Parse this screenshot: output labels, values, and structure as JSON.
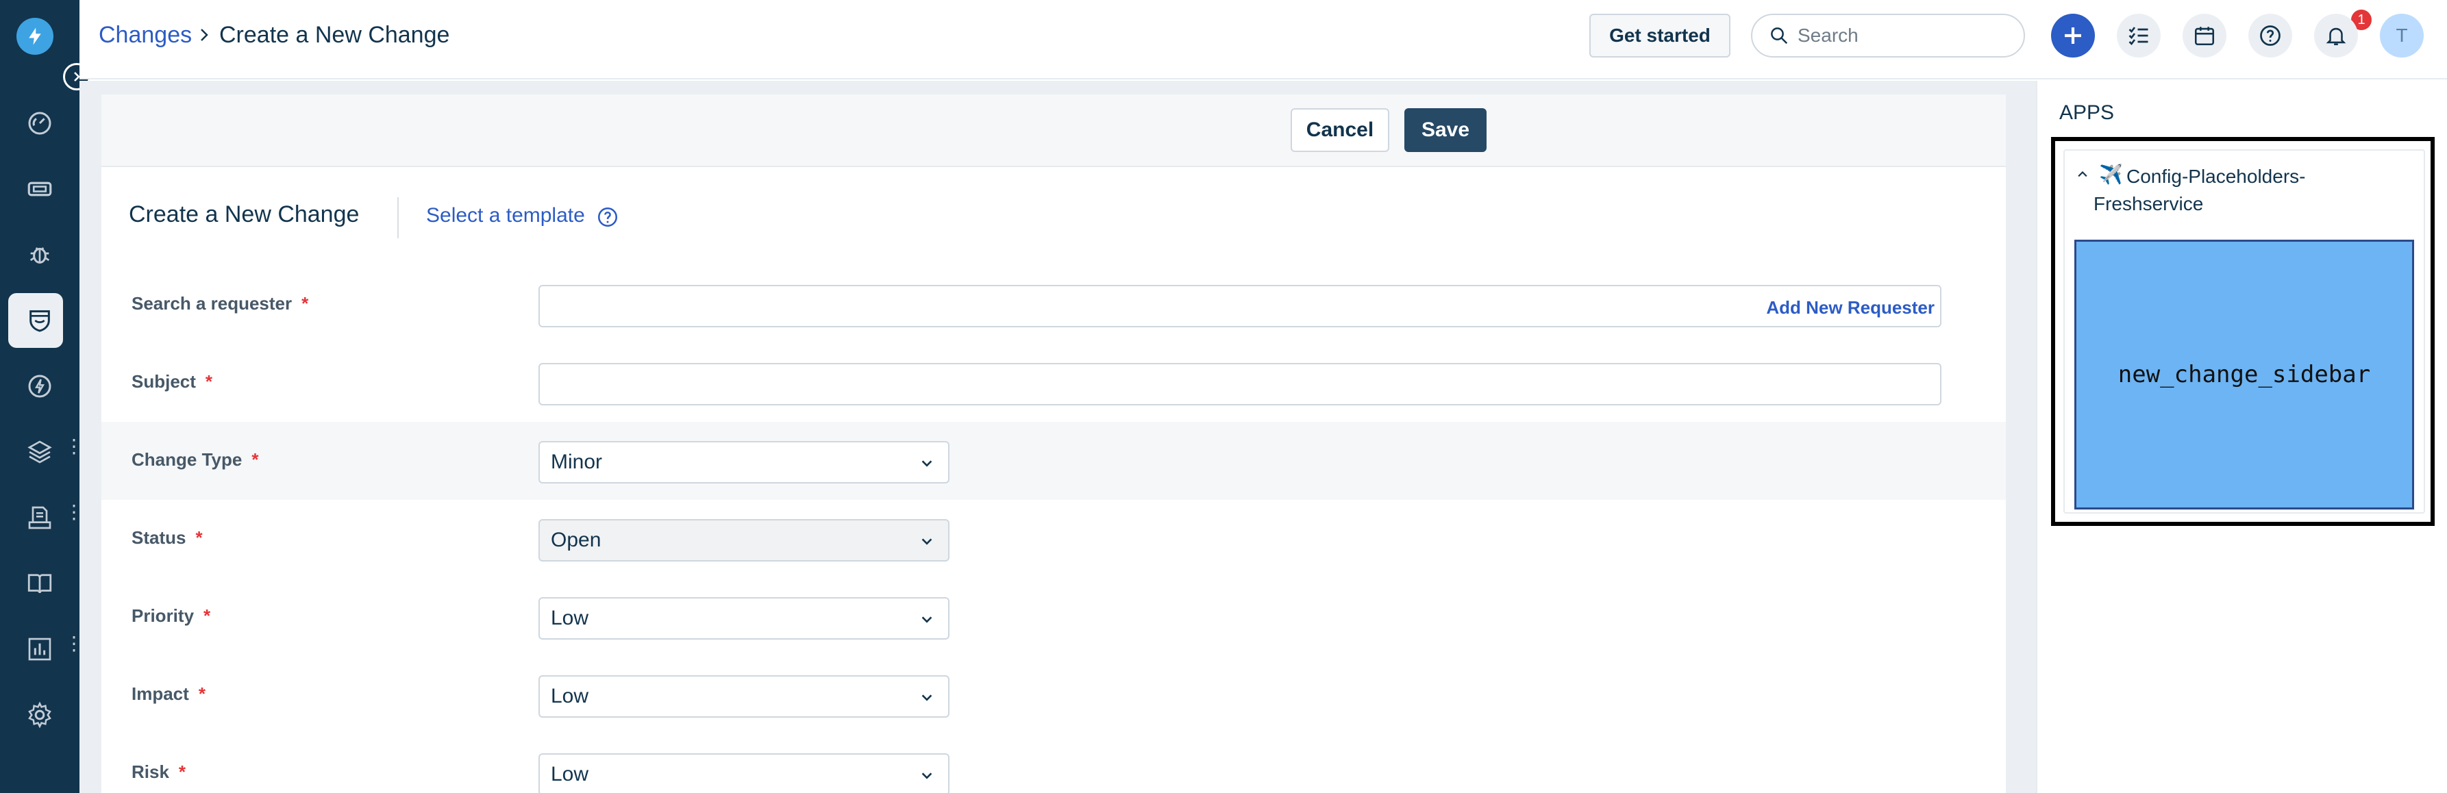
{
  "header": {
    "breadcrumb_link": "Changes",
    "title": "Create a New Change",
    "get_started_label": "Get started",
    "search_placeholder": "Search",
    "help_badge_count": "1",
    "avatar_initial": "T",
    "icons": [
      "plus-icon",
      "todo-list-icon",
      "calendar-icon",
      "help-icon",
      "bell-icon"
    ]
  },
  "sidebar": {
    "items": [
      {
        "name": "dashboard",
        "icon": "gauge-icon"
      },
      {
        "name": "tickets",
        "icon": "ticket-icon"
      },
      {
        "name": "problems",
        "icon": "bug-icon"
      },
      {
        "name": "changes",
        "icon": "shield-icon",
        "active": true
      },
      {
        "name": "releases",
        "icon": "bolt-icon"
      },
      {
        "name": "assets",
        "icon": "layers-icon",
        "has_menu": true
      },
      {
        "name": "contracts",
        "icon": "document-icon",
        "has_menu": true
      },
      {
        "name": "solutions",
        "icon": "book-icon"
      },
      {
        "name": "reports",
        "icon": "chart-icon",
        "has_menu": true
      },
      {
        "name": "admin",
        "icon": "gear-icon"
      }
    ]
  },
  "form": {
    "cancel_label": "Cancel",
    "save_label": "Save",
    "title": "Create a New Change",
    "template_link": "Select a template",
    "fields": {
      "requester": {
        "label": "Search a requester",
        "required": "*",
        "action": "Add New Requester",
        "value": ""
      },
      "subject": {
        "label": "Subject",
        "required": "*",
        "value": ""
      },
      "change_type": {
        "label": "Change Type",
        "required": "*",
        "value": "Minor"
      },
      "status": {
        "label": "Status",
        "required": "*",
        "value": "Open"
      },
      "priority": {
        "label": "Priority",
        "required": "*",
        "value": "Low"
      },
      "impact": {
        "label": "Impact",
        "required": "*",
        "value": "Low"
      },
      "risk": {
        "label": "Risk",
        "required": "*",
        "value": "Low"
      }
    }
  },
  "apps": {
    "title": "APPS",
    "app_name": "Config-Placeholders-Freshservice",
    "app_emoji": "✈️",
    "placeholder_text": "new_change_sidebar",
    "placeholder_color": "#6cb4f4"
  },
  "colors": {
    "rail": "#12344d",
    "link": "#2c5cc5",
    "primary_button": "#264966",
    "required": "#e43538"
  }
}
